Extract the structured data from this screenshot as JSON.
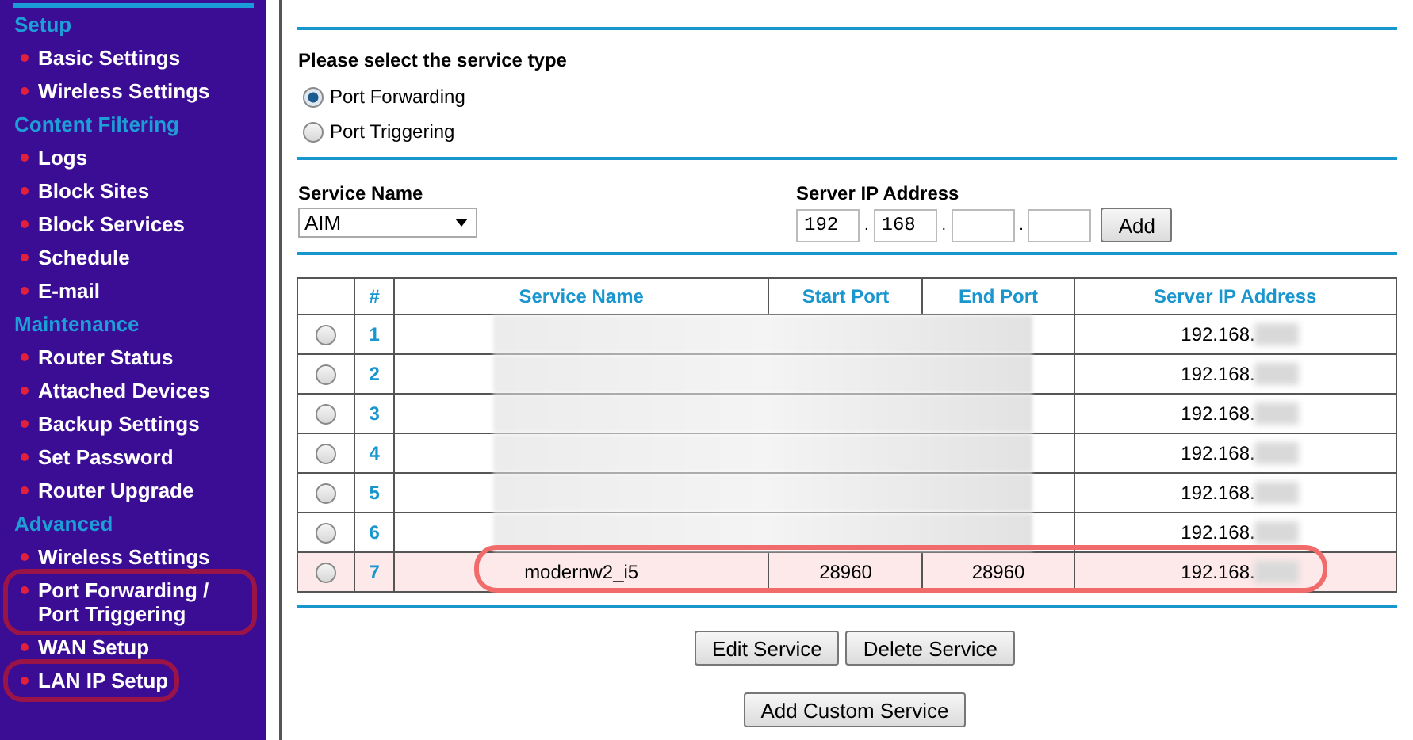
{
  "sidebar": {
    "sections": [
      {
        "title": "Setup",
        "items": [
          {
            "label": "Basic Settings",
            "circled": false
          },
          {
            "label": "Wireless Settings",
            "circled": false
          }
        ]
      },
      {
        "title": "Content Filtering",
        "items": [
          {
            "label": "Logs",
            "circled": false
          },
          {
            "label": "Block Sites",
            "circled": false
          },
          {
            "label": "Block Services",
            "circled": false
          },
          {
            "label": "Schedule",
            "circled": false
          },
          {
            "label": "E-mail",
            "circled": false
          }
        ]
      },
      {
        "title": "Maintenance",
        "items": [
          {
            "label": "Router Status",
            "circled": false
          },
          {
            "label": "Attached Devices",
            "circled": false
          },
          {
            "label": "Backup Settings",
            "circled": false
          },
          {
            "label": "Set Password",
            "circled": false
          },
          {
            "label": "Router Upgrade",
            "circled": false
          }
        ]
      },
      {
        "title": "Advanced",
        "items": [
          {
            "label": "Wireless Settings",
            "circled": false
          },
          {
            "label": "Port Forwarding / Port Triggering",
            "circled": true
          },
          {
            "label": "WAN Setup",
            "circled": false
          },
          {
            "label": "LAN IP Setup",
            "circled": true
          }
        ]
      }
    ]
  },
  "service_type": {
    "title": "Please select the service type",
    "options": [
      {
        "label": "Port Forwarding",
        "selected": true
      },
      {
        "label": "Port Triggering",
        "selected": false
      }
    ]
  },
  "service_name": {
    "label": "Service Name",
    "value": "AIM"
  },
  "server_ip": {
    "label": "Server IP Address",
    "octets": [
      {
        "value": "192"
      },
      {
        "dot": ".",
        "value": "168"
      },
      {
        "dot": "."
      },
      {
        "dot": "."
      }
    ],
    "add_button": "Add"
  },
  "table": {
    "columns": [
      "#",
      "Service Name",
      "Start Port",
      "End Port",
      "Server IP Address"
    ],
    "rows": [
      {
        "number": "1",
        "ip": "192.168.",
        "redacted": true,
        "highlighted": false,
        "selected": false
      },
      {
        "number": "2",
        "ip": "192.168.",
        "redacted": true,
        "highlighted": false,
        "selected": false
      },
      {
        "number": "3",
        "ip": "192.168.",
        "redacted": true,
        "highlighted": false,
        "selected": false
      },
      {
        "number": "4",
        "ip": "192.168.",
        "redacted": true,
        "highlighted": false,
        "selected": false
      },
      {
        "number": "5",
        "ip": "192.168.",
        "redacted": true,
        "highlighted": false,
        "selected": false
      },
      {
        "number": "6",
        "ip": "192.168.",
        "redacted": true,
        "highlighted": false,
        "selected": false
      },
      {
        "number": "7",
        "name": "modernw2_i5",
        "start_port": "28960",
        "end_port": "28960",
        "ip": "192.168.",
        "redacted": false,
        "highlighted": true,
        "selected": false
      }
    ]
  },
  "buttons": [
    "Edit Service",
    "Delete Service"
  ],
  "add_custom_button": "Add Custom Service"
}
